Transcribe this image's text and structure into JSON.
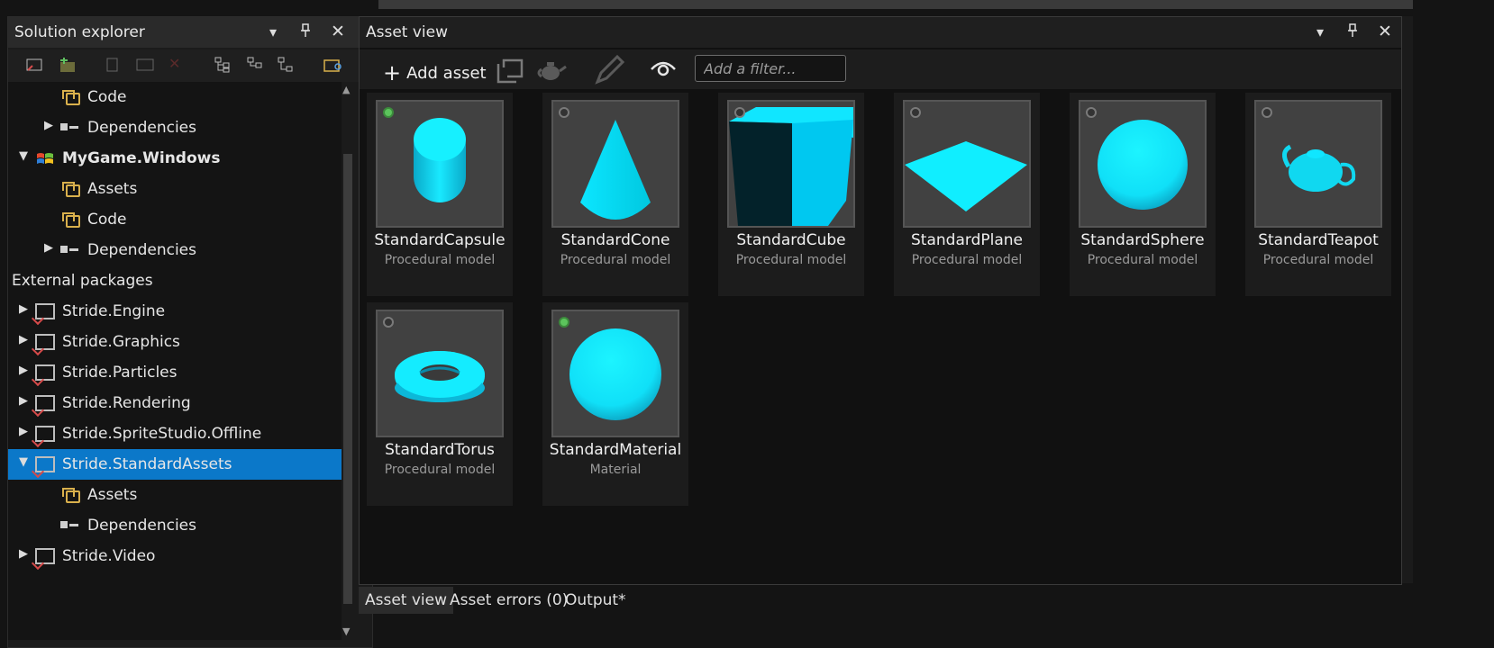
{
  "solution_explorer": {
    "title": "Solution explorer",
    "tree": [
      {
        "label": "Code",
        "icon": "folder-icon",
        "expander": "none"
      },
      {
        "label": "Dependencies",
        "icon": "dependencies-icon",
        "expander": "collapsed"
      },
      {
        "label": "MyGame.Windows",
        "icon": "windows-logo-icon",
        "expander": "expanded",
        "bold": true
      },
      {
        "label": "Assets",
        "icon": "folder-icon",
        "expander": "none"
      },
      {
        "label": "Code",
        "icon": "folder-icon",
        "expander": "none"
      },
      {
        "label": "Dependencies",
        "icon": "dependencies-icon",
        "expander": "collapsed"
      },
      {
        "label": "External packages",
        "icon": "",
        "expander": "expanded"
      },
      {
        "label": "Stride.Engine",
        "icon": "package-project-icon",
        "expander": "collapsed"
      },
      {
        "label": "Stride.Graphics",
        "icon": "package-project-icon",
        "expander": "collapsed"
      },
      {
        "label": "Stride.Particles",
        "icon": "package-project-icon",
        "expander": "collapsed"
      },
      {
        "label": "Stride.Rendering",
        "icon": "package-project-icon",
        "expander": "collapsed"
      },
      {
        "label": "Stride.SpriteStudio.Offline",
        "icon": "package-project-icon",
        "expander": "collapsed"
      },
      {
        "label": "Stride.StandardAssets",
        "icon": "package-project-icon",
        "expander": "expanded",
        "selected": true
      },
      {
        "label": "Assets",
        "icon": "folder-icon",
        "expander": "none"
      },
      {
        "label": "Dependencies",
        "icon": "dependencies-icon",
        "expander": "none"
      },
      {
        "label": "Stride.Video",
        "icon": "package-project-icon",
        "expander": "collapsed"
      }
    ]
  },
  "asset_view": {
    "title": "Asset view",
    "add_asset_label": "Add asset",
    "filter_placeholder": "Add a filter...",
    "assets": [
      {
        "name": "StandardCapsule",
        "type": "Procedural model",
        "shape": "capsule",
        "status": "on"
      },
      {
        "name": "StandardCone",
        "type": "Procedural model",
        "shape": "cone",
        "status": "off"
      },
      {
        "name": "StandardCube",
        "type": "Procedural model",
        "shape": "cube",
        "status": "off"
      },
      {
        "name": "StandardPlane",
        "type": "Procedural model",
        "shape": "plane",
        "status": "off"
      },
      {
        "name": "StandardSphere",
        "type": "Procedural model",
        "shape": "sphere",
        "status": "off"
      },
      {
        "name": "StandardTeapot",
        "type": "Procedural model",
        "shape": "teapot",
        "status": "off"
      },
      {
        "name": "StandardTorus",
        "type": "Procedural model",
        "shape": "torus",
        "status": "off"
      },
      {
        "name": "StandardMaterial",
        "type": "Material",
        "shape": "material-sphere",
        "status": "on"
      }
    ]
  },
  "bottom_tabs": [
    "Asset view",
    "Asset errors (0)",
    "Output*"
  ],
  "colors": {
    "selection": "#0b78c9",
    "shape": "#00f0ff",
    "status_on": "#5cc45c"
  }
}
